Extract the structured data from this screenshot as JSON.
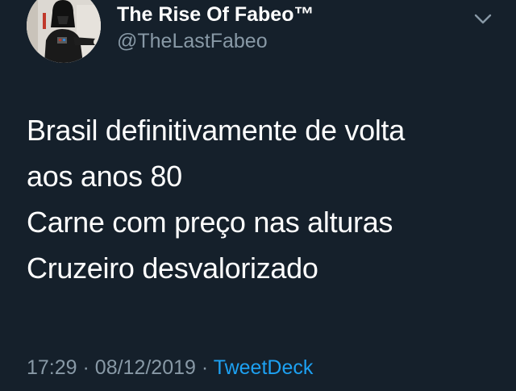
{
  "author": {
    "display_name": "The Rise Of Fabeo™",
    "handle": "@TheLastFabeo",
    "avatar_icon": "avatar-darth-vader-costume"
  },
  "tweet": {
    "lines": [
      "Brasil definitivamente de volta",
      "aos anos 80",
      "Carne com preço nas alturas",
      "Cruzeiro desvalorizado"
    ],
    "time": "17:29",
    "separator": "·",
    "date": "08/12/2019",
    "source": "TweetDeck"
  },
  "menu": {
    "icon": "chevron-down-icon"
  },
  "colors": {
    "background": "#15202b",
    "text": "#ffffff",
    "secondary_text": "#8899a6",
    "link": "#1da1f2"
  }
}
